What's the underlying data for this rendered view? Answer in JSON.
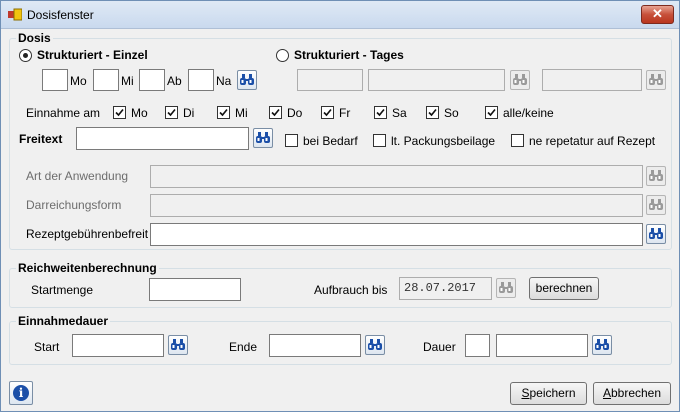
{
  "window": {
    "title": "Dosisfenster",
    "close_label": "✕"
  },
  "dosis": {
    "group_title": "Dosis",
    "radio_einzel_label": "Strukturiert - Einzel",
    "radio_tages_label": "Strukturiert - Tages",
    "radio_selected": "einzel",
    "einzel_fields": {
      "mo": "Mo",
      "mi": "Mi",
      "ab": "Ab",
      "na": "Na"
    },
    "einnahme_label": "Einnahme am",
    "days": [
      {
        "label": "Mo",
        "checked": true
      },
      {
        "label": "Di",
        "checked": true
      },
      {
        "label": "Mi",
        "checked": true
      },
      {
        "label": "Do",
        "checked": true
      },
      {
        "label": "Fr",
        "checked": true
      },
      {
        "label": "Sa",
        "checked": true
      },
      {
        "label": "So",
        "checked": true
      },
      {
        "label": "alle/keine",
        "checked": true
      }
    ],
    "freitext_label": "Freitext",
    "freitext_value": "",
    "opt_bedarf": "bei Bedarf",
    "opt_packungsbeilage": "lt. Packungsbeilage",
    "opt_repetatur": "ne repetatur auf Rezept",
    "art_label": "Art der Anwendung",
    "darreichung_label": "Darreichungsform",
    "rezept_label": "Rezeptgebührenbefreit"
  },
  "reichweite": {
    "group_title": "Reichweitenberechnung",
    "startmenge_label": "Startmenge",
    "aufbrauch_label": "Aufbrauch bis",
    "aufbrauch_value": "28.07.2017",
    "berechnen_label": "berechnen"
  },
  "einnahmedauer": {
    "group_title": "Einnahmedauer",
    "start_label": "Start",
    "ende_label": "Ende",
    "dauer_label": "Dauer"
  },
  "footer": {
    "save_label": "Speichern",
    "save_mnemonic": "S",
    "cancel_label": "Abbrechen",
    "cancel_mnemonic": "A"
  },
  "colors": {
    "accent": "#1b4fa8",
    "close": "#c7503a"
  }
}
